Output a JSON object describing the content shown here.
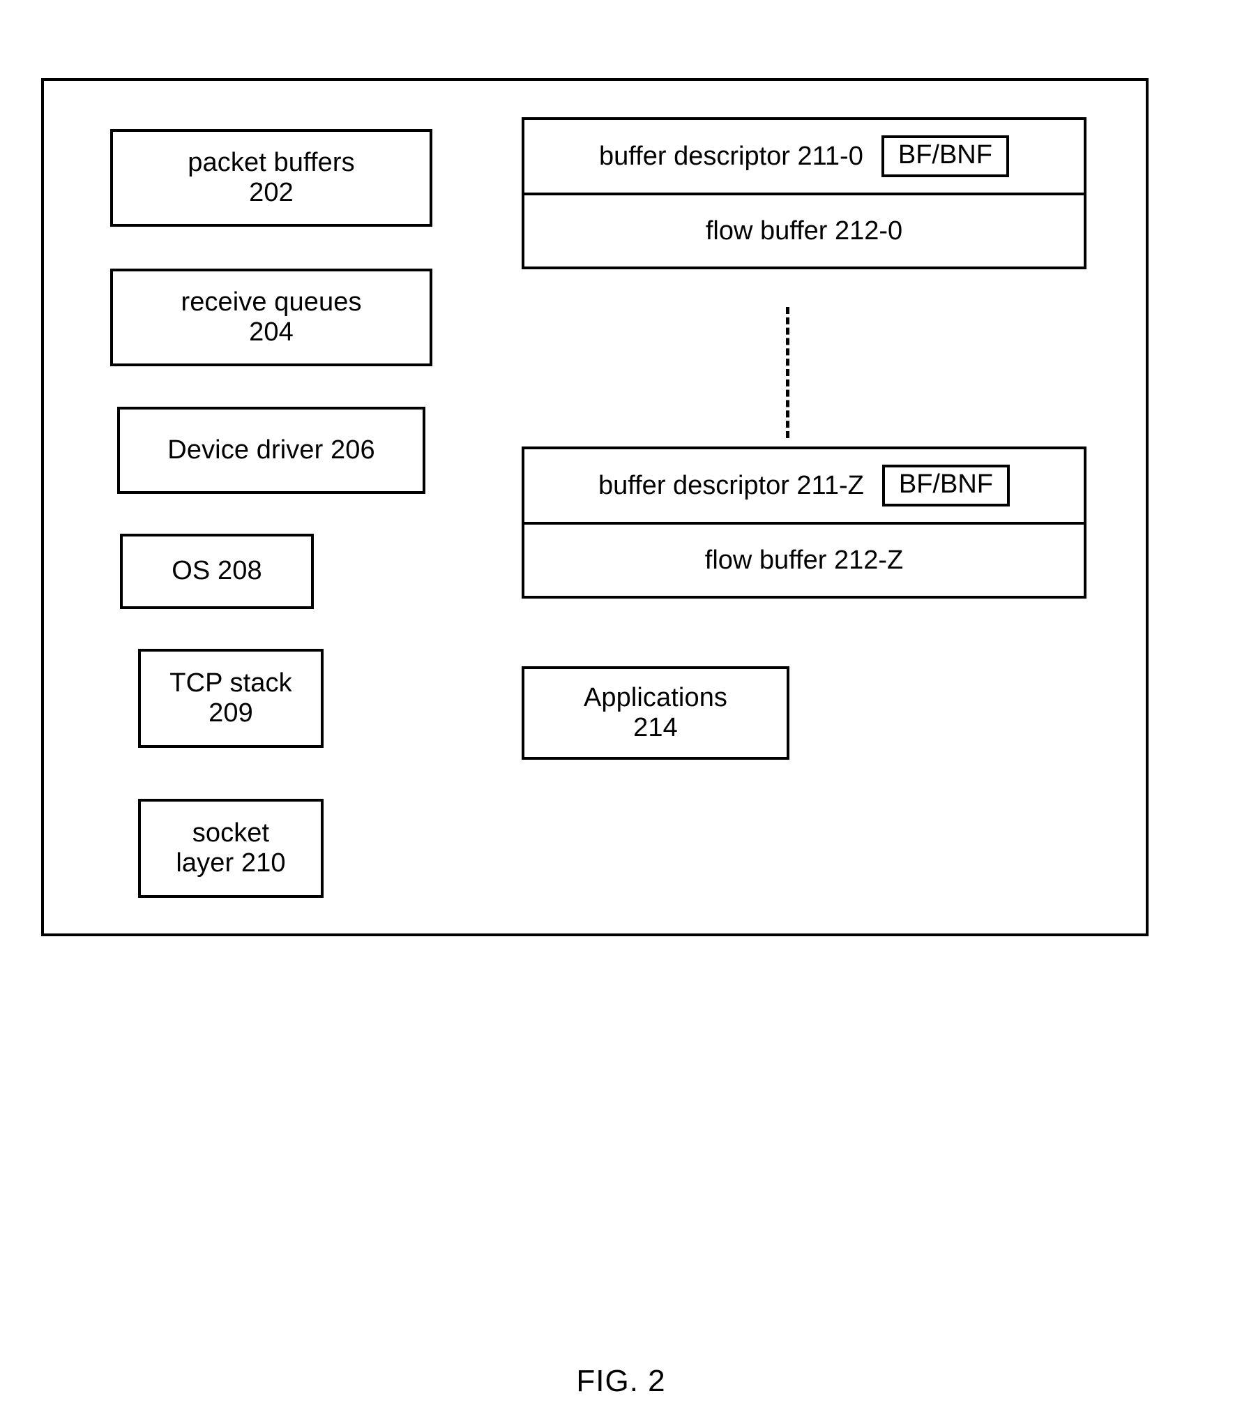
{
  "figure": {
    "caption": "FIG. 2"
  },
  "left_column": {
    "boxes": [
      {
        "name": "packet-buffers",
        "label": "packet buffers\n202"
      },
      {
        "name": "receive-queues",
        "label": "receive queues\n204"
      },
      {
        "name": "device-driver",
        "label": "Device driver 206"
      },
      {
        "name": "os",
        "label": "OS 208"
      },
      {
        "name": "tcp-stack",
        "label": "TCP stack\n209"
      },
      {
        "name": "socket-layer",
        "label": "socket\nlayer 210"
      }
    ]
  },
  "right_column": {
    "buffer_groups": [
      {
        "name": "buffer-group-0",
        "descriptor_label": "buffer descriptor 211-0",
        "flag_label": "BF/BNF",
        "flow_buffer_label": "flow buffer 212-0"
      },
      {
        "name": "buffer-group-z",
        "descriptor_label": "buffer descriptor 211-Z",
        "flag_label": "BF/BNF",
        "flow_buffer_label": "flow buffer 212-Z"
      }
    ],
    "applications": {
      "label": "Applications\n214"
    }
  },
  "colors": {
    "stroke": "#000000",
    "background": "#ffffff"
  }
}
